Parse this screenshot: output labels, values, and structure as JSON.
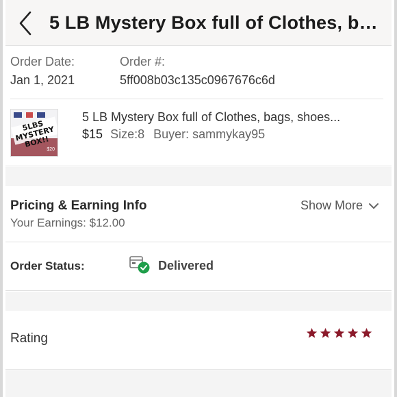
{
  "header": {
    "title": "5 LB Mystery Box full of Clothes, ba..."
  },
  "order": {
    "date_label": "Order Date:",
    "date_value": "Jan 1, 2021",
    "number_label": "Order #:",
    "number_value": "5ff008b03c135c0967676c6d"
  },
  "item": {
    "title": "5 LB Mystery Box full of Clothes, bags, shoes...",
    "price": "$15",
    "size": "Size:8",
    "buyer": "Buyer: sammykay95",
    "thumb_text": "5LBS MYSTERY BOX!!",
    "thumb_price": "$20"
  },
  "pricing": {
    "title": "Pricing & Earning Info",
    "earnings": "Your Earnings: $12.00",
    "show_more": "Show More"
  },
  "status": {
    "label": "Order Status:",
    "value": "Delivered"
  },
  "rating": {
    "label": "Rating",
    "stars": 5,
    "max": 5,
    "color": "#8b1a2b"
  }
}
